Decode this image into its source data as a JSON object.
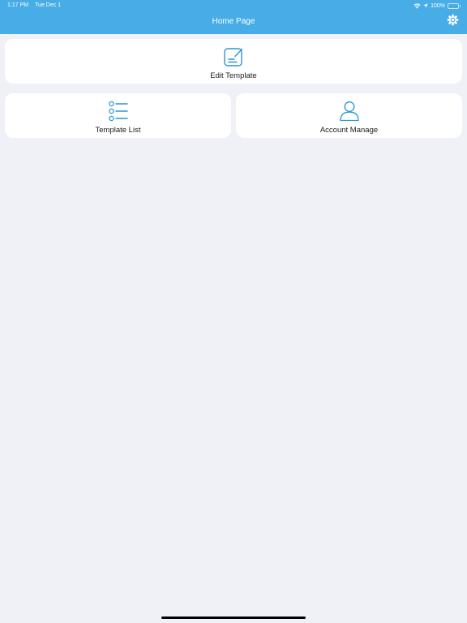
{
  "status_bar": {
    "time": "1:17 PM",
    "date": "Tue Dec 1",
    "battery": "100%",
    "icons": [
      "wifi-icon",
      "location-arrow-icon",
      "battery-icon"
    ]
  },
  "nav": {
    "title": "Home Page",
    "settings_icon": "gear-icon"
  },
  "cards": {
    "edit_template": {
      "label": "Edit Template",
      "icon": "edit-note-icon"
    },
    "template_list": {
      "label": "Template List",
      "icon": "list-icon"
    },
    "account_manage": {
      "label": "Account Manage",
      "icon": "person-icon"
    }
  },
  "colors": {
    "accent": "#48ade6",
    "icon": "#2a96d6",
    "background": "#eff1f7",
    "card": "#ffffff"
  }
}
